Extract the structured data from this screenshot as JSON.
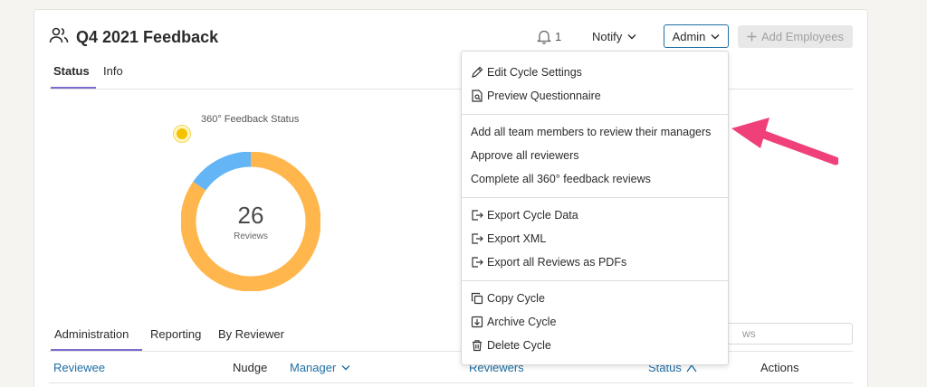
{
  "header": {
    "title": "Q4 2021 Feedback",
    "bell_count": "1",
    "notify_label": "Notify",
    "admin_label": "Admin",
    "add_employees_label": "Add Employees"
  },
  "tabs_top": [
    {
      "label": "Status"
    },
    {
      "label": "Info"
    }
  ],
  "status_chart": {
    "label": "360° Feedback Status",
    "total": "26",
    "unit": "Reviews"
  },
  "chart_data": {
    "type": "pie",
    "title": "360° Feedback Status",
    "total": 26,
    "slices": [
      {
        "value": 22,
        "color": "#ffb74d"
      },
      {
        "value": 4,
        "color": "#64b5f6"
      }
    ]
  },
  "tabs_bottom": [
    {
      "label": "Administration"
    },
    {
      "label": "Reporting"
    },
    {
      "label": "By Reviewer"
    }
  ],
  "search": {
    "visible_text": "ws"
  },
  "table": {
    "columns": [
      "Reviewee",
      "Nudge",
      "Manager",
      "Reviewers",
      "Status",
      "Actions"
    ]
  },
  "admin_menu": {
    "items": [
      {
        "label": "Edit Cycle Settings"
      },
      {
        "label": "Preview Questionnaire"
      },
      {
        "label": "Add all team members to review their managers"
      },
      {
        "label": "Approve all reviewers"
      },
      {
        "label": "Complete all 360° feedback reviews"
      },
      {
        "label": "Export Cycle Data"
      },
      {
        "label": "Export XML"
      },
      {
        "label": "Export all Reviews as PDFs"
      },
      {
        "label": "Copy Cycle"
      },
      {
        "label": "Archive Cycle"
      },
      {
        "label": "Delete Cycle"
      }
    ]
  },
  "colors": {
    "accent": "#1e6fa6",
    "tab_underline": "#7b6bd1",
    "arrow": "#f0407a"
  }
}
